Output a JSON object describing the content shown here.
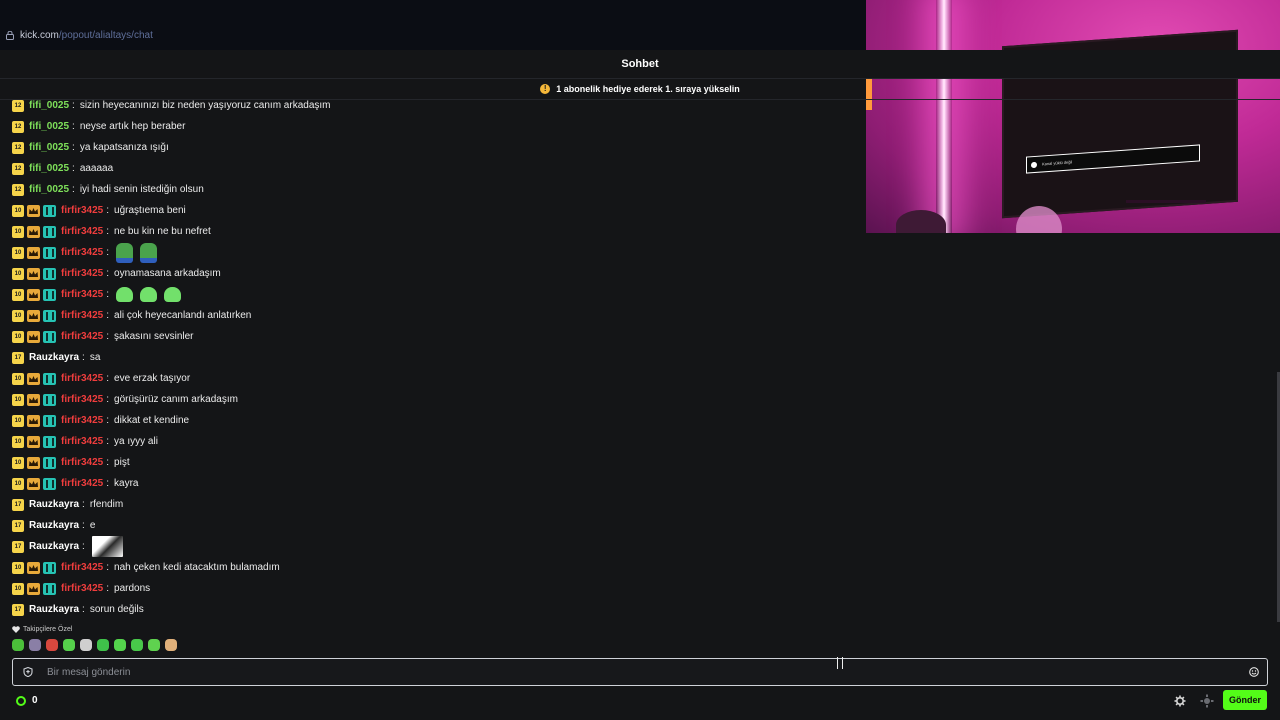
{
  "browser": {
    "url_host": "kick.com",
    "url_path": "/popout/alialtays/chat"
  },
  "video": {
    "tv_overlay_text": "Kanal yüklü değil"
  },
  "chat": {
    "title": "Sohbet",
    "banner": "1 abonelik hediye ederek 1. sıraya yükselin",
    "messages": [
      {
        "badge": "12",
        "user": "fifi_0025",
        "color": "fifi",
        "crown": false,
        "kick": false,
        "text": "sizin heyecanınızı biz neden yaşıyoruz canım arkadaşım"
      },
      {
        "badge": "12",
        "user": "fifi_0025",
        "color": "fifi",
        "crown": false,
        "kick": false,
        "text": "neyse artık hep beraber"
      },
      {
        "badge": "12",
        "user": "fifi_0025",
        "color": "fifi",
        "crown": false,
        "kick": false,
        "text": "ya kapatsanıza ışığı"
      },
      {
        "badge": "12",
        "user": "fifi_0025",
        "color": "fifi",
        "crown": false,
        "kick": false,
        "text": "aaaaaa"
      },
      {
        "badge": "12",
        "user": "fifi_0025",
        "color": "fifi",
        "crown": false,
        "kick": false,
        "text": "iyi hadi senin istediğin olsun"
      },
      {
        "badge": "10",
        "user": "firfir3425",
        "color": "firfir",
        "crown": true,
        "kick": true,
        "text": "uğraştıema beni"
      },
      {
        "badge": "10",
        "user": "firfir3425",
        "color": "firfir",
        "crown": true,
        "kick": true,
        "text": "ne bu kin ne bu nefret"
      },
      {
        "badge": "10",
        "user": "firfir3425",
        "color": "firfir",
        "crown": true,
        "kick": true,
        "text": "",
        "emotes": [
          "pepe",
          "pepe"
        ]
      },
      {
        "badge": "10",
        "user": "firfir3425",
        "color": "firfir",
        "crown": true,
        "kick": true,
        "text": "oynamasana arkadaşım"
      },
      {
        "badge": "10",
        "user": "firfir3425",
        "color": "firfir",
        "crown": true,
        "kick": true,
        "text": "",
        "emotes": [
          "ghost",
          "ghost",
          "ghost"
        ]
      },
      {
        "badge": "10",
        "user": "firfir3425",
        "color": "firfir",
        "crown": true,
        "kick": true,
        "text": "ali çok heyecanlandı anlatırken"
      },
      {
        "badge": "10",
        "user": "firfir3425",
        "color": "firfir",
        "crown": true,
        "kick": true,
        "text": "şakasını sevsinler"
      },
      {
        "badge": "17",
        "user": "Rauzkayra",
        "color": "rauz",
        "crown": false,
        "kick": false,
        "text": "sa"
      },
      {
        "badge": "10",
        "user": "firfir3425",
        "color": "firfir",
        "crown": true,
        "kick": true,
        "text": "eve erzak taşıyor"
      },
      {
        "badge": "10",
        "user": "firfir3425",
        "color": "firfir",
        "crown": true,
        "kick": true,
        "text": "görüşürüz canım arkadaşım"
      },
      {
        "badge": "10",
        "user": "firfir3425",
        "color": "firfir",
        "crown": true,
        "kick": true,
        "text": "dikkat et kendine"
      },
      {
        "badge": "10",
        "user": "firfir3425",
        "color": "firfir",
        "crown": true,
        "kick": true,
        "text": "ya ıyyy ali"
      },
      {
        "badge": "10",
        "user": "firfir3425",
        "color": "firfir",
        "crown": true,
        "kick": true,
        "text": "pişt"
      },
      {
        "badge": "10",
        "user": "firfir3425",
        "color": "firfir",
        "crown": true,
        "kick": true,
        "text": "kayra"
      },
      {
        "badge": "17",
        "user": "Rauzkayra",
        "color": "rauz",
        "crown": false,
        "kick": false,
        "text": "rfendim"
      },
      {
        "badge": "17",
        "user": "Rauzkayra",
        "color": "rauz",
        "crown": false,
        "kick": false,
        "text": "e"
      },
      {
        "badge": "17",
        "user": "Rauzkayra",
        "color": "rauz",
        "crown": false,
        "kick": false,
        "text": "",
        "emotes": [
          "pic"
        ]
      },
      {
        "badge": "10",
        "user": "firfir3425",
        "color": "firfir",
        "crown": true,
        "kick": true,
        "text": "nah çeken kedi atacaktım bulamadım"
      },
      {
        "badge": "10",
        "user": "firfir3425",
        "color": "firfir",
        "crown": true,
        "kick": true,
        "text": "pardons"
      },
      {
        "badge": "17",
        "user": "Rauzkayra",
        "color": "rauz",
        "crown": false,
        "kick": false,
        "text": "sorun değils"
      }
    ]
  },
  "emote_tray": {
    "label": "Takipçilere Özel",
    "colors": [
      "#4bbf3a",
      "#8a7fa6",
      "#d8483e",
      "#55d04b",
      "#cfcfcf",
      "#3fc24a",
      "#54d34c",
      "#48c84a",
      "#5fd24f",
      "#e0b07a"
    ]
  },
  "composer": {
    "placeholder": "Bir mesaj gönderin",
    "value": ""
  },
  "footer": {
    "points": "0",
    "send_label": "Gönder"
  },
  "colors": {
    "accent": "#53fc18",
    "sub_badge": "#f6d44a",
    "kick_badge": "#26c3b4"
  }
}
